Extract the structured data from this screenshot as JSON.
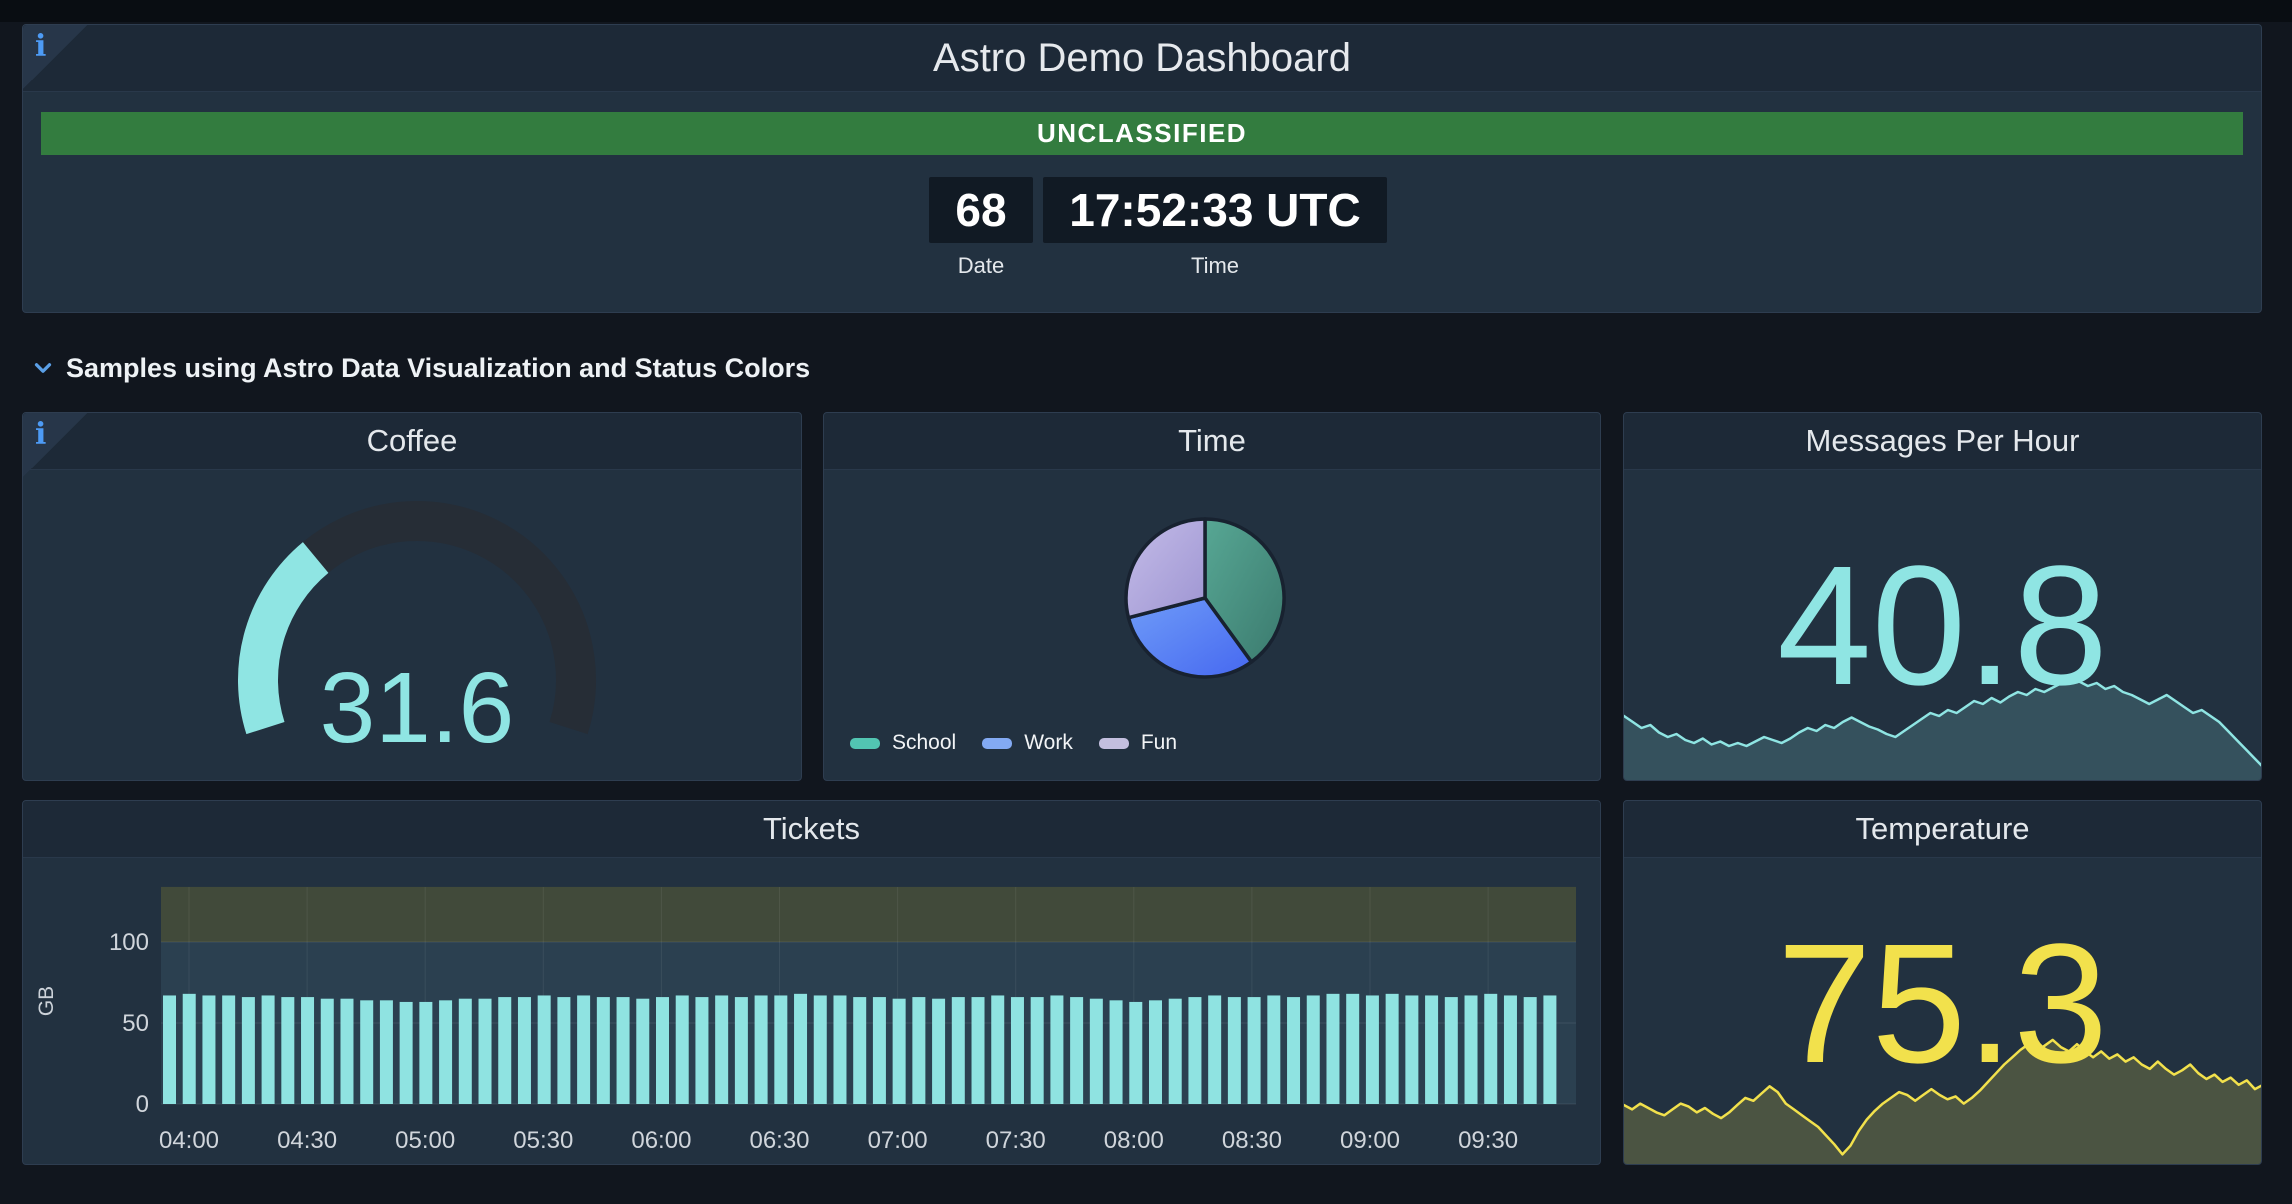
{
  "page": {
    "background": "#11161e",
    "accent_teal": "#8fe5e3",
    "accent_yellow": "#f2e14c"
  },
  "header": {
    "title": "Astro Demo Dashboard",
    "classification_banner": "UNCLASSIFIED",
    "classification_color": "#337c3f",
    "clock": {
      "date_value": "68",
      "date_label": "Date",
      "time_value": "17:52:33 UTC",
      "time_label": "Time"
    }
  },
  "row": {
    "title": "Samples using Astro Data Visualization and Status Colors"
  },
  "panels": {
    "coffee": {
      "title": "Coffee",
      "value": "31.6"
    },
    "time": {
      "title": "Time",
      "legend": [
        {
          "label": "School",
          "color": "#52c5b2"
        },
        {
          "label": "Work",
          "color": "#83aaf3"
        },
        {
          "label": "Fun",
          "color": "#c3bfdf"
        }
      ]
    },
    "messages": {
      "title": "Messages Per Hour",
      "value": "40.8"
    },
    "tickets": {
      "title": "Tickets",
      "ylabel": "GB"
    },
    "temperature": {
      "title": "Temperature",
      "value": "75.3"
    }
  },
  "chart_data": [
    {
      "type": "gauge",
      "panel": "Coffee",
      "value": 31.6,
      "min": 0,
      "max": 100,
      "fill_color": "#8fe5e3",
      "track_color": "#262d36"
    },
    {
      "type": "pie",
      "panel": "Time",
      "slices": [
        {
          "label": "School",
          "value": 40,
          "color_from": "#57a794",
          "color_to": "#3b7a6e"
        },
        {
          "label": "Work",
          "value": 31,
          "color_from": "#6f9cf8",
          "color_to": "#4668f0"
        },
        {
          "label": "Fun",
          "value": 29,
          "color_from": "#c4bce8",
          "color_to": "#9e95d2"
        }
      ],
      "legend_position": "bottom-left"
    },
    {
      "type": "area",
      "panel": "Messages Per Hour",
      "stat": 40.8,
      "line_color": "#8fe5e3",
      "fill_color": "rgba(143,229,227,0.18)",
      "values": [
        44,
        40,
        36,
        38,
        33,
        30,
        32,
        28,
        26,
        29,
        25,
        27,
        24,
        26,
        24,
        27,
        30,
        28,
        26,
        29,
        33,
        36,
        34,
        38,
        36,
        40,
        43,
        40,
        37,
        35,
        32,
        30,
        34,
        38,
        42,
        46,
        44,
        48,
        46,
        50,
        54,
        52,
        56,
        53,
        57,
        60,
        58,
        62,
        60,
        63,
        66,
        70,
        67,
        64,
        66,
        62,
        64,
        60,
        58,
        55,
        52,
        55,
        58,
        54,
        50,
        46,
        48,
        44,
        40,
        34,
        28,
        22,
        16,
        10
      ]
    },
    {
      "type": "bar",
      "panel": "Tickets",
      "ylabel": "GB",
      "yticks": [
        0,
        50,
        100
      ],
      "ylim": [
        0,
        134
      ],
      "x_ticks": [
        "04:00",
        "04:30",
        "05:00",
        "05:30",
        "06:00",
        "06:30",
        "07:00",
        "07:30",
        "08:00",
        "08:30",
        "09:00",
        "09:30"
      ],
      "bar_color": "#8fe3e1",
      "threshold_bands": [
        {
          "from": 100,
          "to": 134,
          "color": "#414a3a"
        },
        {
          "from": 0,
          "to": 100,
          "color": "#2b4050"
        }
      ],
      "values": [
        67,
        68,
        67,
        67,
        66,
        67,
        66,
        66,
        65,
        65,
        64,
        64,
        63,
        63,
        64,
        65,
        65,
        66,
        66,
        67,
        66,
        67,
        66,
        66,
        65,
        66,
        67,
        66,
        67,
        66,
        67,
        67,
        68,
        67,
        67,
        66,
        66,
        65,
        66,
        65,
        66,
        66,
        67,
        66,
        66,
        67,
        66,
        65,
        64,
        63,
        64,
        65,
        66,
        67,
        66,
        66,
        67,
        66,
        67,
        68,
        68,
        67,
        68,
        67,
        67,
        66,
        67,
        68,
        67,
        66,
        67
      ]
    },
    {
      "type": "area",
      "panel": "Temperature",
      "stat": 75.3,
      "line_color": "#f2e14c",
      "fill_color": "rgba(242,225,76,0.2)",
      "values": [
        42,
        39,
        43,
        40,
        37,
        35,
        39,
        43,
        41,
        37,
        40,
        36,
        33,
        37,
        42,
        47,
        45,
        50,
        55,
        51,
        43,
        39,
        35,
        31,
        27,
        21,
        15,
        8,
        14,
        24,
        32,
        38,
        43,
        47,
        51,
        49,
        45,
        49,
        53,
        49,
        46,
        48,
        43,
        47,
        52,
        58,
        64,
        70,
        75,
        80,
        84,
        79,
        83,
        87,
        82,
        79,
        84,
        79,
        75,
        79,
        74,
        77,
        72,
        75,
        70,
        67,
        72,
        67,
        63,
        66,
        70,
        64,
        60,
        63,
        58,
        61,
        56,
        59,
        53,
        56
      ]
    }
  ]
}
